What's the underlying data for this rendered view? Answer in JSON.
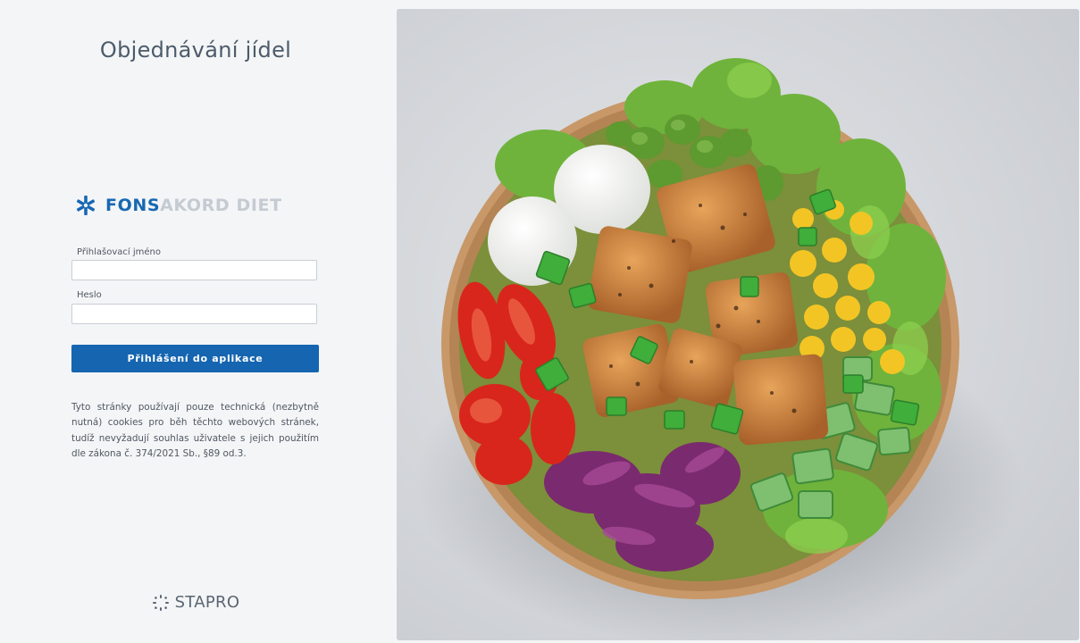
{
  "app": {
    "title": "Objednávání jídel"
  },
  "brand": {
    "strong": "FONS",
    "light": "AKORD DIET",
    "icon": "snowflake-star-icon",
    "accent_color": "#1768b3"
  },
  "login_form": {
    "username_label": "Přihlašovací jméno",
    "username_value": "",
    "password_label": "Heslo",
    "password_value": "",
    "submit_label": "Přihlášení do aplikace",
    "button_color": "#1565b0"
  },
  "cookie_note": "Tyto stránky používají pouze technická (nezbytně nutná) cookies pro běh těchto webových stránek, tudíž nevyžadují souhlas uživatele s jejich použitím dle zákona č. 374/2021 Sb., §89 od.3.",
  "vendor": {
    "name": "STAPRO",
    "icon": "dotted-ring-icon"
  },
  "hero_image": {
    "icon": "food-bowl-photo"
  }
}
